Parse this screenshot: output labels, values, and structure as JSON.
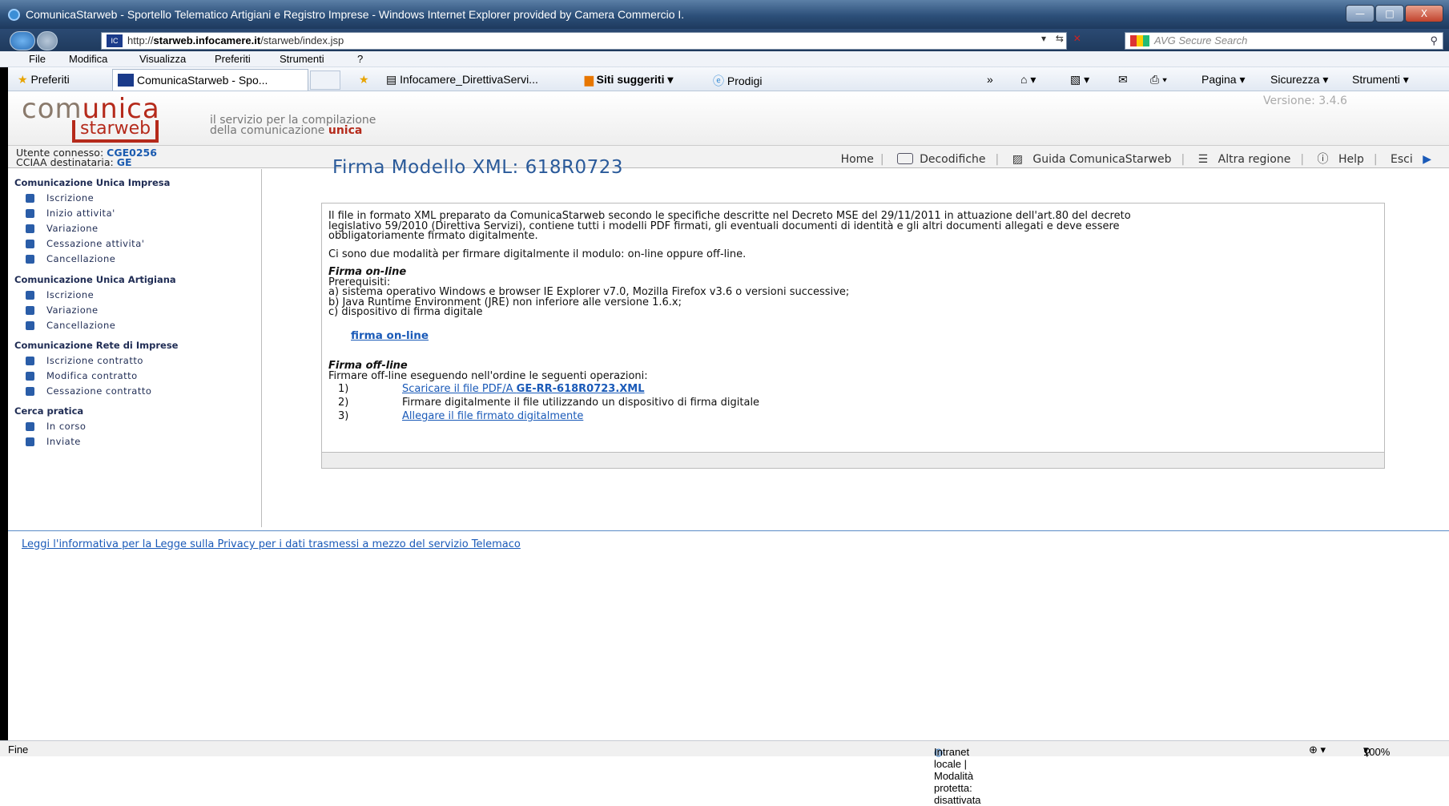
{
  "window": {
    "title": "ComunicaStarweb - Sportello Telematico Artigiani e Registro Imprese - Windows Internet Explorer provided by Camera Commercio I.",
    "minimize": "—",
    "maximize": "□",
    "close": "X"
  },
  "address": {
    "url_prefix": "http://",
    "url_host": "starweb.infocamere.it",
    "url_path": "/starweb/index.jsp",
    "search_placeholder": "AVG Secure Search"
  },
  "menu": [
    "File",
    "Modifica",
    "Visualizza",
    "Preferiti",
    "Strumenti",
    "?"
  ],
  "favbar": {
    "favorites": "Preferiti",
    "tab_title": "ComunicaStarweb - Spo...",
    "link1": "Infocamere_DirettivaServi...",
    "link2": "Siti suggeriti",
    "link3": "Prodigi",
    "overflow": "»",
    "page_menu": "Pagina",
    "security_menu": "Sicurezza",
    "tools_menu": "Strumenti"
  },
  "header": {
    "logo_top_a": "com",
    "logo_top_b": "unica",
    "logo_bottom": "starweb",
    "slogan_line1": "il servizio per la compilazione",
    "slogan_line2": "della comunicazione",
    "slogan_emph": "unica",
    "version": "Versione: 3.4.6"
  },
  "user": {
    "label1": "Utente connesso:",
    "value1": "CGE0256",
    "label2": "CCIAA destinataria:",
    "value2": "GE"
  },
  "topnav": {
    "home": "Home",
    "decodifiche": "Decodifiche",
    "guida": "Guida ComunicaStarweb",
    "altra_regione": "Altra regione",
    "help": "Help",
    "esci": "Esci"
  },
  "sidebar": {
    "groups": [
      {
        "title": "Comunicazione Unica Impresa",
        "items": [
          "Iscrizione",
          "Inizio attivita'",
          "Variazione",
          "Cessazione attivita'",
          "Cancellazione"
        ]
      },
      {
        "title": "Comunicazione Unica Artigiana",
        "items": [
          "Iscrizione",
          "Variazione",
          "Cancellazione"
        ]
      },
      {
        "title": "Comunicazione Rete di Imprese",
        "items": [
          "Iscrizione contratto",
          "Modifica contratto",
          "Cessazione contratto"
        ]
      },
      {
        "title": "Cerca pratica",
        "items": [
          "In corso",
          "Inviate"
        ]
      }
    ]
  },
  "main": {
    "title": "Firma Modello XML: 618R0723",
    "intro_l1": "Il file in formato XML preparato da ComunicaStarweb secondo le specifiche descritte nel Decreto MSE del 29/11/2011 in attuazione dell'art.80 del decreto",
    "intro_l2": "legislativo 59/2010 (Direttiva Servizi), contiene tutti i modelli PDF firmati, gli eventuali documenti di identità e gli altri documenti allegati e deve essere",
    "intro_l3": "obbligatoriamente firmato digitalmente.",
    "modes": "Ci sono due modalità per firmare digitalmente il modulo: on-line oppure off-line.",
    "online_title": "Firma on-line",
    "prereq": "Prerequisiti:",
    "req_a": "a) sistema operativo Windows e browser IE Explorer v7.0, Mozilla Firefox v3.6 o versioni successive;",
    "req_b": "b) Java Runtime Environment (JRE) non inferiore alle versione 1.6.x;",
    "req_c": "c) dispositivo di firma digitale",
    "online_link": "firma on-line",
    "offline_title": "Firma off-line",
    "offline_intro": "Firmare off-line eseguendo nell'ordine le seguenti operazioni:",
    "steps": [
      {
        "n": "1)",
        "pre": "Scaricare il file PDF/A ",
        "file": "GE-RR-618R0723.XML"
      },
      {
        "n": "2)",
        "text": "Firmare digitalmente il file utilizzando un dispositivo di firma digitale"
      },
      {
        "n": "3)",
        "text": "Allegare il file firmato digitalmente"
      }
    ]
  },
  "footer": {
    "privacy": "Leggi l'informativa per la Legge sulla Privacy per i dati trasmessi a mezzo del servizio Telemaco"
  },
  "status": {
    "left": "Fine",
    "zone": "Intranet locale | Modalità protetta: disattivata",
    "zoom": "100%"
  }
}
